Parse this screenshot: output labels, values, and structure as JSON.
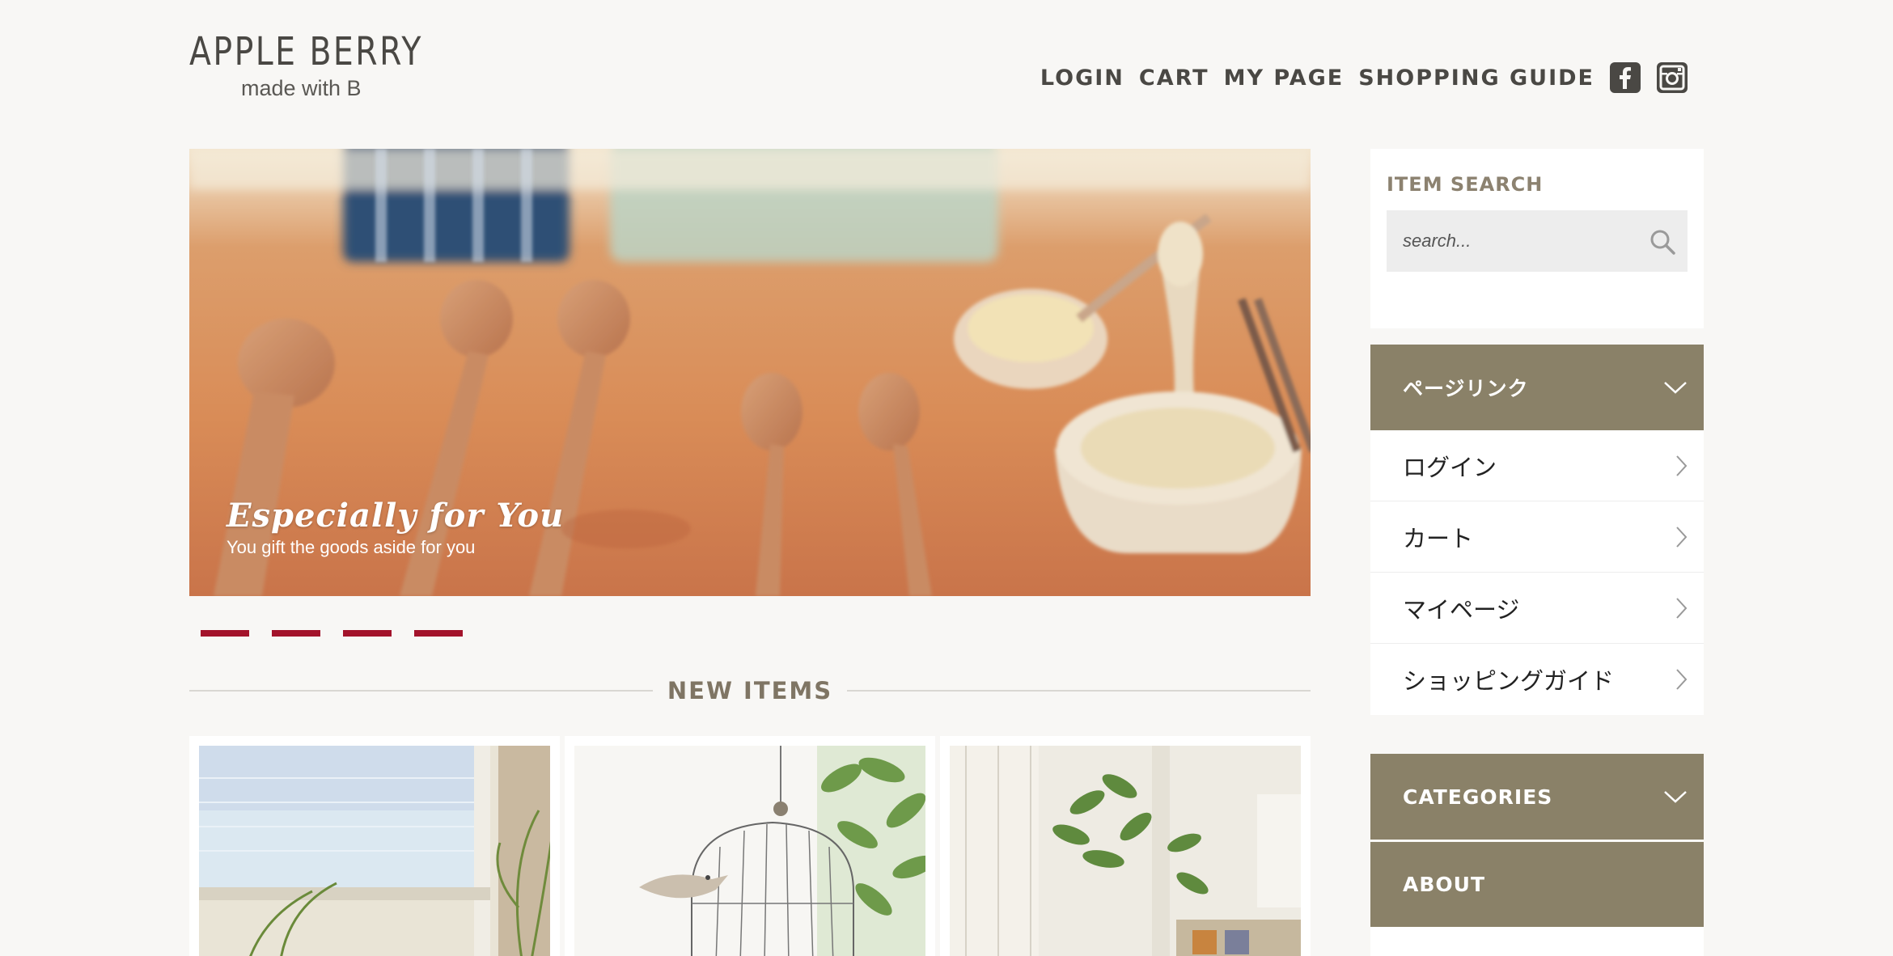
{
  "brand": {
    "name": "APPLE BERRY",
    "tagline": "made with B"
  },
  "header_nav": {
    "items": [
      "LOGIN",
      "CART",
      "MY PAGE",
      "SHOPPING GUIDE"
    ],
    "social": [
      "facebook-icon",
      "instagram-icon"
    ]
  },
  "hero": {
    "title": "Especially for You",
    "subtitle": "You gift the goods aside for you",
    "slide_count": 4
  },
  "new_items": {
    "heading": "NEW ITEMS"
  },
  "search": {
    "title": "ITEM SEARCH",
    "placeholder": "search..."
  },
  "sidebar": {
    "page_links_title": "ページリンク",
    "page_links": [
      {
        "label": "ログイン"
      },
      {
        "label": "カート"
      },
      {
        "label": "マイページ"
      },
      {
        "label": "ショッピングガイド"
      }
    ],
    "categories_title": "CATEGORIES",
    "about_title": "ABOUT"
  },
  "colors": {
    "background": "#f8f7f5",
    "accent_olive": "#8a8168",
    "slider_dot": "#a3132b",
    "text_dark": "#4a4844"
  }
}
